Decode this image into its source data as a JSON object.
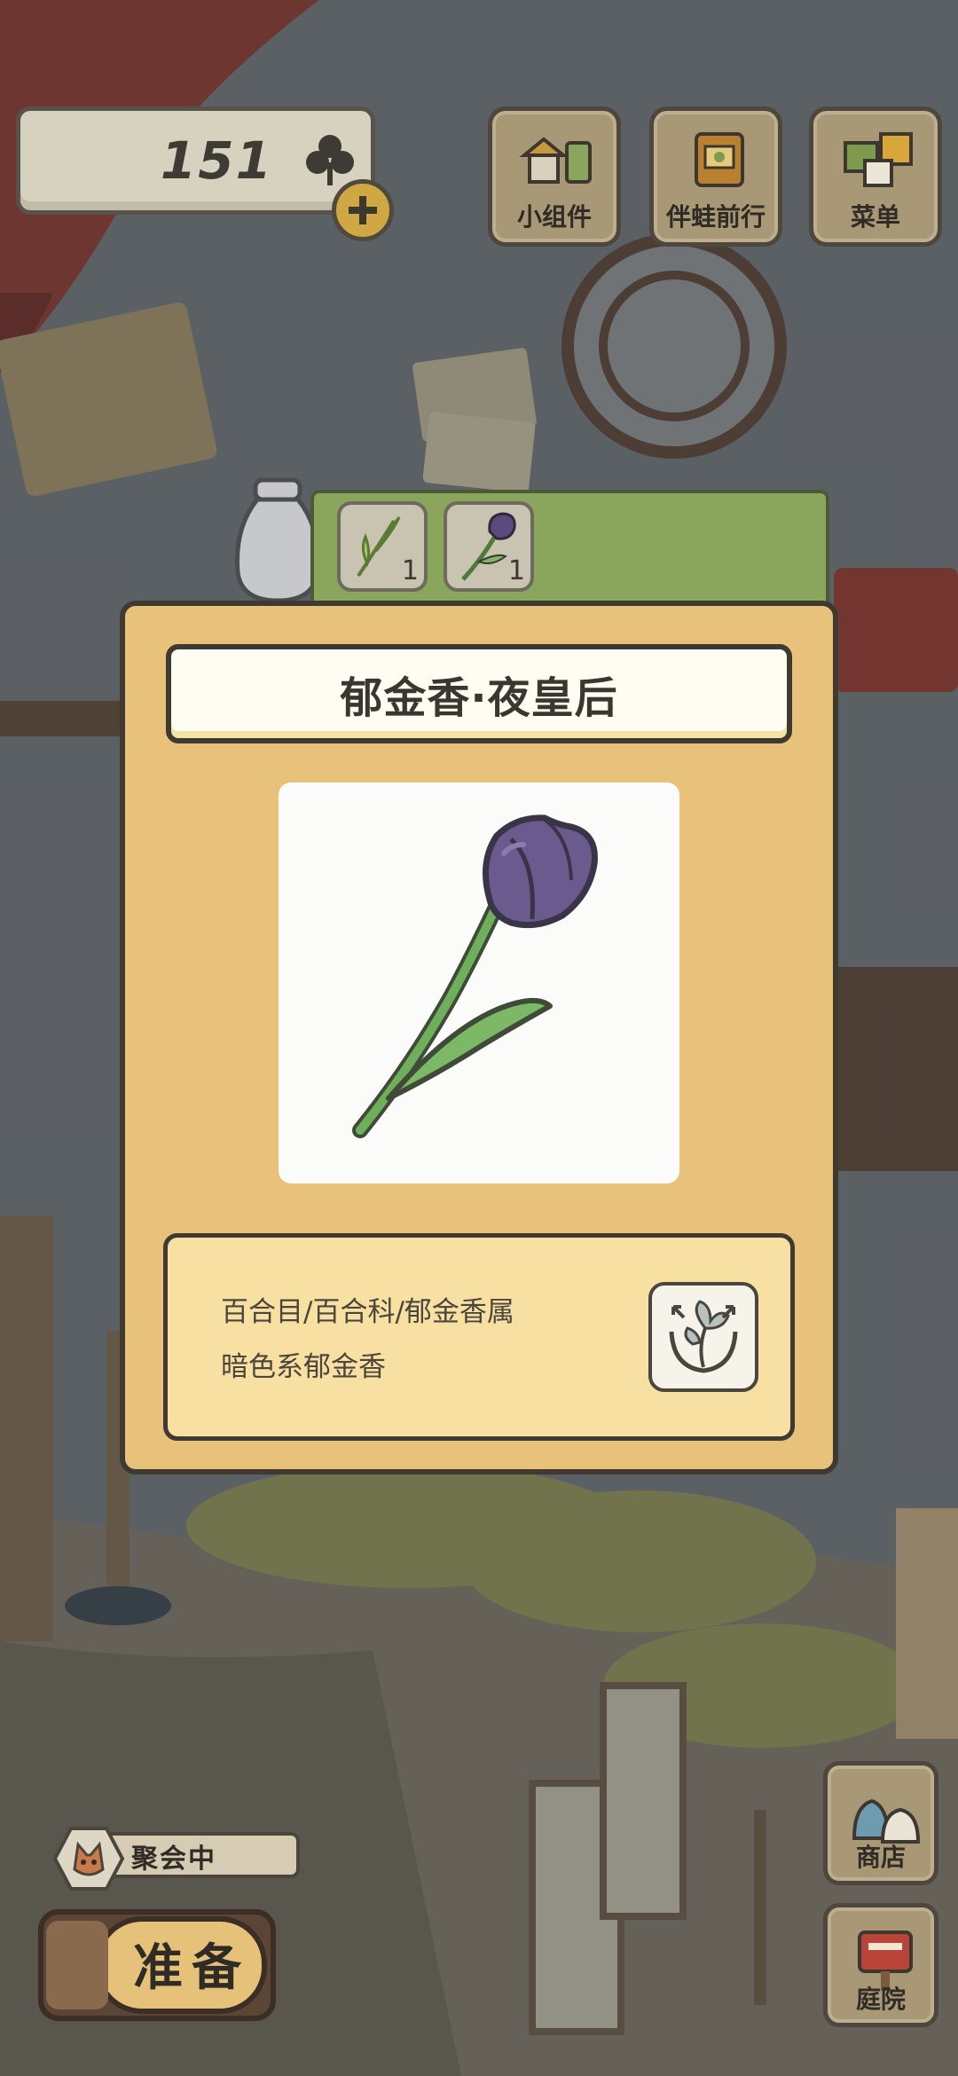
{
  "currency": {
    "clovers": "151",
    "icon": "clover-icon",
    "add_icon": "plus-icon"
  },
  "top_menu": [
    {
      "label": "小组件",
      "icon": "widget-icon"
    },
    {
      "label": "伴蛙前行",
      "icon": "journey-book-icon"
    },
    {
      "label": "菜单",
      "icon": "menu-cards-icon"
    }
  ],
  "specimen_tabs": [
    {
      "icon": "leaf-sprout-icon",
      "count": "1"
    },
    {
      "icon": "purple-tulip-icon",
      "count": "1"
    }
  ],
  "specimen": {
    "title": "郁金香·夜皇后",
    "taxonomy": "百合目/百合科/郁金香属",
    "description": "暗色系郁金香",
    "share_icon": "share-flower-icon",
    "flower_color": "#6b5a8e",
    "leaf_color": "#7cb865"
  },
  "party": {
    "label": "聚会中",
    "icon": "fox-avatar-icon"
  },
  "prepare": {
    "label": "准备"
  },
  "side_menu": [
    {
      "label": "商店",
      "icon": "shop-bags-icon"
    },
    {
      "label": "庭院",
      "icon": "mailbox-icon"
    }
  ]
}
